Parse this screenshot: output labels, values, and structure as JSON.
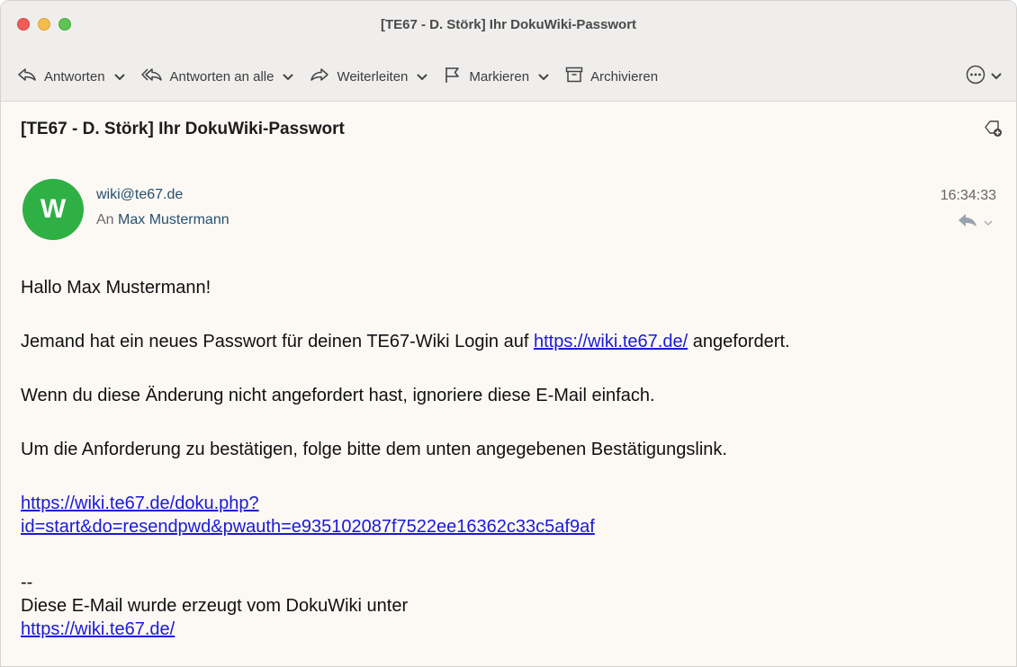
{
  "window": {
    "title": "[TE67 - D. Störk] Ihr DokuWiki-Passwort"
  },
  "toolbar": {
    "reply_label": "Antworten",
    "reply_all_label": "Antworten an alle",
    "forward_label": "Weiterleiten",
    "flag_label": "Markieren",
    "archive_label": "Archivieren"
  },
  "message": {
    "subject": "[TE67 - D. Störk] Ihr DokuWiki-Passwort",
    "avatar_letter": "W",
    "avatar_color": "#2fb044",
    "sender": "wiki@te67.de",
    "to_prefix": "An",
    "to_name": "Max Mustermann",
    "time": "16:34:33"
  },
  "body": {
    "greeting": "Hallo Max Mustermann!",
    "line1_before": "Jemand hat ein neues Passwort für deinen TE67-Wiki Login auf ",
    "line1_link": "https://wiki.te67.de/",
    "line1_after": " angefordert.",
    "line2": "Wenn du diese Änderung nicht angefordert hast, ignoriere diese E-Mail einfach.",
    "line3": "Um die Anforderung zu bestätigen, folge bitte dem unten angegebenen Bestätigungslink.",
    "confirm_link_part1": "https://wiki.te67.de/doku.php?",
    "confirm_link_part2": "id=start&do=resendpwd&pwauth=e935102087f7522ee16362c33c5af9af",
    "sig_dashes": "--",
    "sig_text": "Diese E-Mail wurde erzeugt vom DokuWiki unter",
    "sig_link": "https://wiki.te67.de/"
  },
  "colors": {
    "link": "#1a1ad6",
    "sender": "#25516f",
    "background": "#fcf8f4"
  }
}
